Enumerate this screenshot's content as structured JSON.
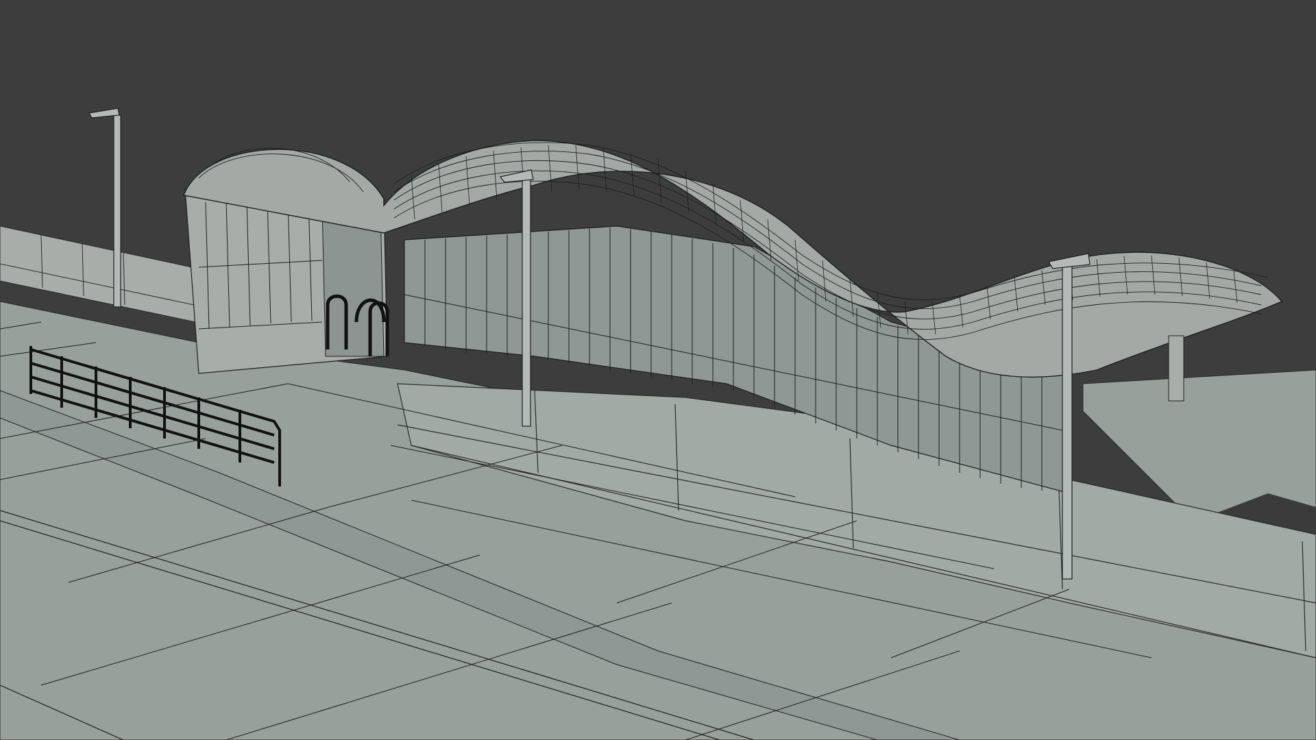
{
  "viewport": {
    "background": "#3d3d3d",
    "ground_color": "#98a09c",
    "shade_color": "#8f9894",
    "edge_color": "#2a2a2a",
    "render_mode": "wireframe-on-shaded"
  },
  "scene": {
    "objects": [
      "ground-slab",
      "railway-track",
      "parapet-wall",
      "curved-canopy-shelter",
      "glazed-wall",
      "lamp-posts",
      "pedestrian-railing",
      "bicycle-racks"
    ]
  }
}
